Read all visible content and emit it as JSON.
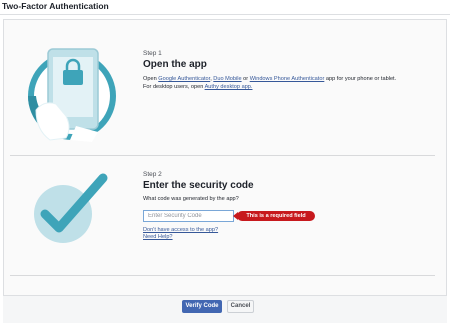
{
  "window": {
    "title": "Two-Factor Authentication"
  },
  "step1": {
    "label": "Step 1",
    "title": "Open the app",
    "line1_prefix": "Open ",
    "line1_link1": "Google Authenticator",
    "line1_sep1": ", ",
    "line1_link2": "Duo Mobile",
    "line1_sep2": " or ",
    "line1_link3": "Windows Phone Authenticator",
    "line1_suffix": " app for your phone or tablet.",
    "line2_prefix": "For desktop users, open ",
    "line2_link": "Authy desktop app."
  },
  "step2": {
    "label": "Step 2",
    "title": "Enter the security code",
    "question": "What code was generated by the app?",
    "input": {
      "placeholder": "Enter Security Code",
      "value": ""
    },
    "error": "This is a required field",
    "link_access": "Don't have access to the app?",
    "link_help": "Need Help?"
  },
  "footer": {
    "verify_label": "Verify Code",
    "cancel_label": "Cancel"
  },
  "colors": {
    "accent": "#4267b2",
    "link": "#365899",
    "error": "#c7191d",
    "illustration_teal": "#3ea4b9",
    "illustration_light": "#bfe0e8"
  },
  "icons": {
    "step1_illustration": "phone-lock-icon",
    "step2_illustration": "checkmark-circle-icon"
  }
}
